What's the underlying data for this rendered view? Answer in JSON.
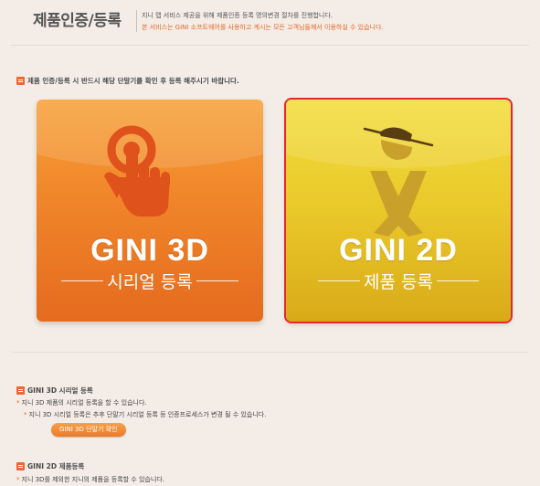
{
  "header": {
    "title": "제품인증/등록",
    "line1": "지니 맵 서비스 제공을 위해 제품인증 등록 명의변경 절차를 진행합니다.",
    "line2": "본 서비스는 GINI 소프트웨어를 사용하고 계시는 모든 고객님들께서 이용하실 수 있습니다."
  },
  "notice": "제품 인증/등록 시 반드시 해당 단말기를 확인 후 등록 해주시기 바랍니다.",
  "tiles": {
    "gini3d": {
      "name": "GINI 3D",
      "sub": "시리얼 등록"
    },
    "gini2d": {
      "name": "GINI 2D",
      "sub": "제품 등록"
    }
  },
  "section3d": {
    "title": "GINI 3D 시리얼 등록",
    "bullet1": "지니 3D 제품의 시리얼 등록을 할 수 있습니다.",
    "bullet2": "지니 3D 시리얼 등록은 추후 단말기 시리얼 등록 등 인증프로세스가 변경 될 수 있습니다.",
    "button": "GINI 3D 단말기 확인"
  },
  "section2d": {
    "title": "GINI 2D 제품등록",
    "bullet1": "지니 3D를 제외한 지니의 제품을 등록할 수 있습니다."
  },
  "colors": {
    "accent": "#e86a31",
    "tile3d": "#f0852a",
    "tile2d": "#e9c82a",
    "selected_border": "#e8262e"
  }
}
